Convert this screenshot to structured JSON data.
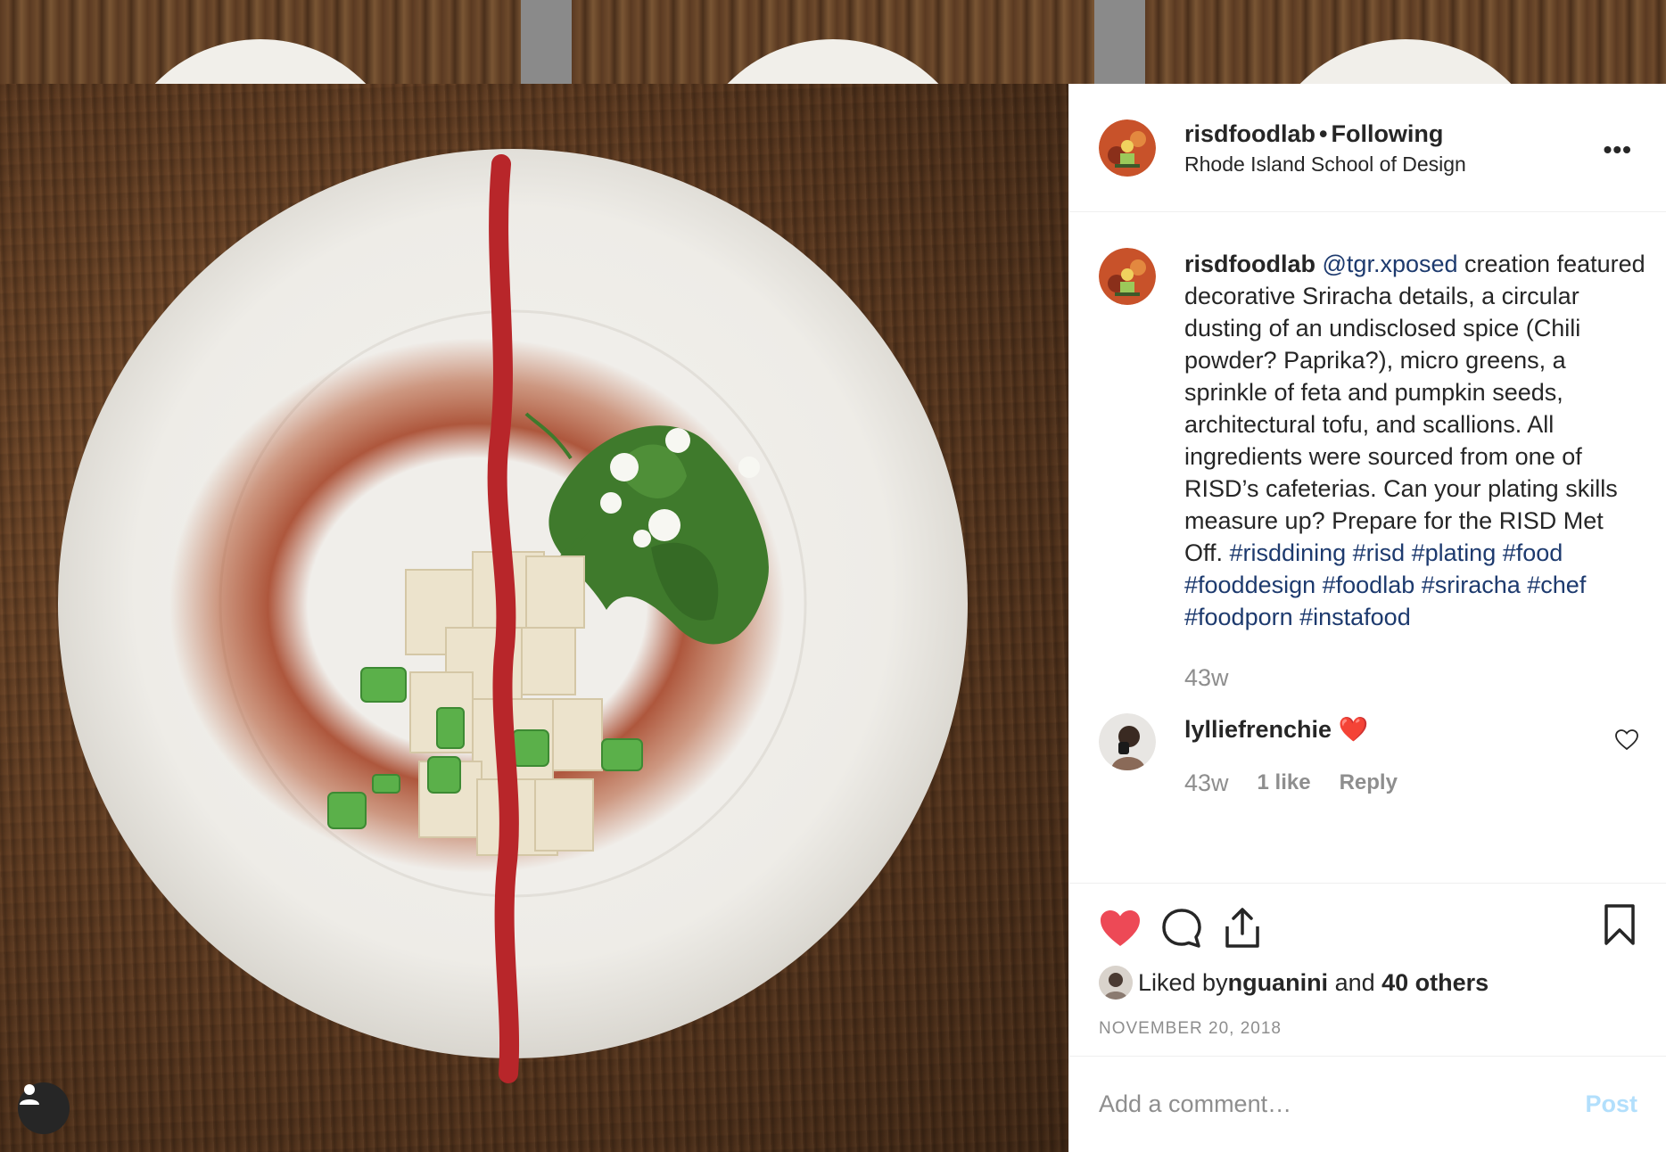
{
  "header": {
    "username": "risdfoodlab",
    "separator": "•",
    "follow_status": "Following",
    "location": "Rhode Island School of Design",
    "more_icon": "ellipsis-icon"
  },
  "caption": {
    "username": "risdfoodlab",
    "mention": "@tgr.xposed",
    "text": " creation featured decorative Sriracha details, a circular dusting of an undisclosed spice (Chili powder? Paprika?), micro greens, a sprinkle of feta and pumpkin seeds, architectural tofu, and scallions. All ingredients were sourced from one of RISD’s cafeterias. Can your plating skills measure up? Prepare for the RISD Met Off. ",
    "hashtags": "#risddining #risd #plating #food #fooddesign #foodlab #sriracha #chef #foodporn #instafood",
    "time": "43w"
  },
  "reply": {
    "username": "lylliefrenchie",
    "emoji": "❤️",
    "time": "43w",
    "likes": "1 like",
    "reply_label": "Reply"
  },
  "actions": {
    "liked_prefix": "Liked by ",
    "liked_user": "nguanini",
    "liked_and": " and ",
    "liked_others": "40 others",
    "date": "NOVEMBER 20, 2018"
  },
  "add_comment": {
    "placeholder": "Add a comment…",
    "post_label": "Post"
  },
  "colors": {
    "heart": "#ed4956",
    "link": "#1d3a6e",
    "muted": "#8e8e8e",
    "post_disabled": "#b2dffc"
  }
}
